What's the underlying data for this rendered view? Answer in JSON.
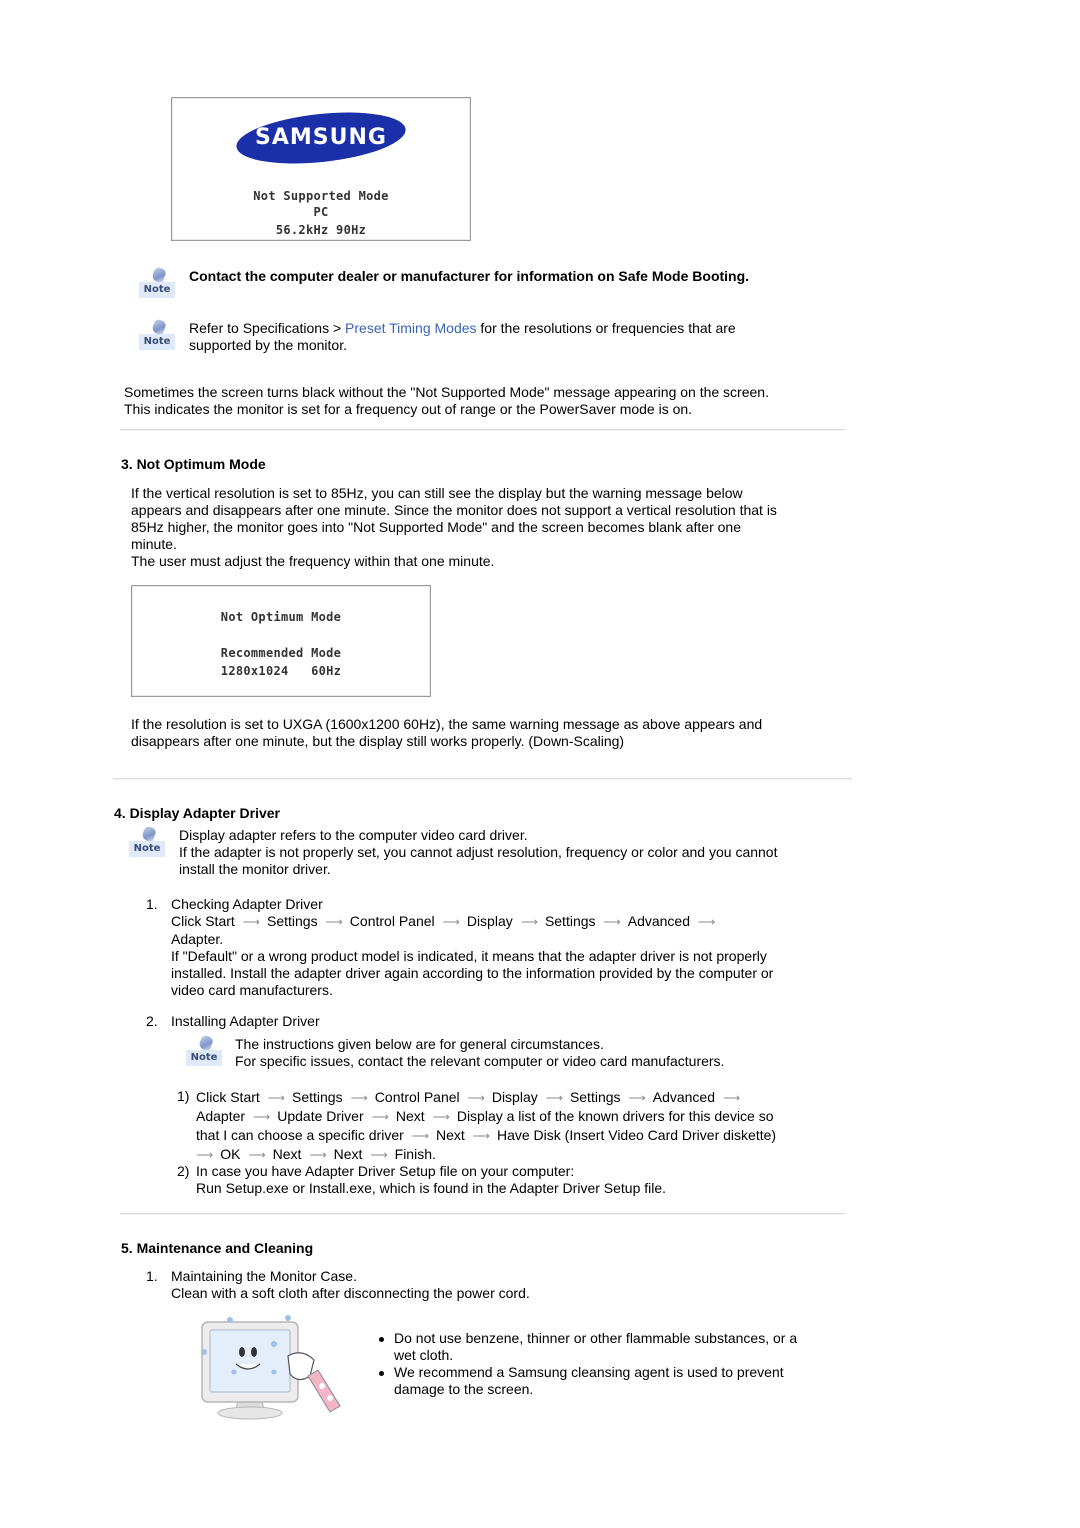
{
  "osd_not_supported": {
    "brand": "SAMSUNG",
    "line1": "Not Supported Mode",
    "line2": "PC",
    "line3": "56.2kHz 90Hz"
  },
  "notes": {
    "note_label": "Note",
    "safe_mode": "Contact the computer dealer or manufacturer for information on Safe Mode Booting.",
    "refer_prefix": "Refer to Specifications > ",
    "refer_link": "Preset Timing Modes",
    "refer_suffix_line1": " for the resolutions or frequencies that are",
    "refer_line2": "supported by the monitor."
  },
  "black_screen": {
    "line1": "Sometimes the screen turns black without the \"Not Supported Mode\" message appearing on the screen.",
    "line2": "This indicates the monitor is set for a frequency out of range or the PowerSaver mode is on."
  },
  "section3": {
    "heading": "3. Not Optimum Mode",
    "para_lines": [
      "If the vertical resolution is set to 85Hz, you can still see the display but the warning message below",
      "appears and disappears after one minute. Since the monitor does not support a vertical resolution that is",
      "85Hz higher, the monitor goes into \"Not Supported Mode\" and the screen becomes blank after one",
      "minute.",
      "The user must adjust the frequency within that one minute."
    ],
    "osd": {
      "line1": "Not Optimum Mode",
      "line2": "Recommended Mode",
      "line3": "1280x1024   60Hz"
    },
    "uxga_lines": [
      "If the resolution is set to UXGA (1600x1200 60Hz), the same warning message as above appears and",
      "disappears after one minute, but the display still works properly. (Down-Scaling)"
    ]
  },
  "section4": {
    "heading": "4. Display Adapter Driver",
    "note_lines": [
      "Display adapter refers to the computer video card driver.",
      "If the adapter is not properly set, you cannot adjust resolution, frequency or color and you cannot",
      "install the monitor driver."
    ],
    "item1": {
      "num": "1.",
      "title": "Checking Adapter Driver",
      "path_prefix": "Click Start",
      "path_steps": [
        "Settings",
        "Control Panel",
        "Display",
        "Settings",
        "Advanced"
      ],
      "path_end": "Adapter.",
      "desc_lines": [
        "If \"Default\" or a wrong product model is indicated, it means that the adapter driver is not properly",
        "installed. Install the adapter driver again according to the information provided by the computer or",
        "video card manufacturers."
      ]
    },
    "item2": {
      "num": "2.",
      "title": "Installing Adapter Driver",
      "note_lines": [
        "The instructions given below are for general circumstances.",
        "For specific issues, contact the relevant computer or video card manufacturers."
      ],
      "sub1": {
        "num": "1)",
        "row1": [
          "Click Start",
          "Settings",
          "Control Panel",
          "Display",
          "Settings",
          "Advanced"
        ],
        "row2": [
          "Adapter",
          "Update Driver",
          "Next",
          "Display a list of the known drivers for this device so"
        ],
        "row3": [
          "that I can choose a specific driver",
          "Next",
          "Have Disk (Insert Video Card Driver diskette)"
        ],
        "row4": [
          "OK",
          "Next",
          "Next",
          "Finish."
        ]
      },
      "sub2": {
        "num": "2)",
        "line1": "In case you have Adapter Driver Setup file on your computer:",
        "line2": "Run Setup.exe or Install.exe, which is found in the Adapter Driver Setup file."
      }
    }
  },
  "section5": {
    "heading": "5. Maintenance and Cleaning",
    "item1": {
      "num": "1.",
      "title": "Maintaining the Monitor Case.",
      "desc": "Clean with a soft cloth after disconnecting the power cord."
    },
    "bullets": [
      [
        "Do not use benzene, thinner or other flammable substances, or a",
        "wet cloth."
      ],
      [
        "We recommend a Samsung cleansing agent is used to prevent",
        "damage to the screen."
      ]
    ]
  },
  "colors": {
    "link": "#3a64b4",
    "samsung_blue": "#1a2fa8",
    "divider": "#dcdcdc"
  }
}
